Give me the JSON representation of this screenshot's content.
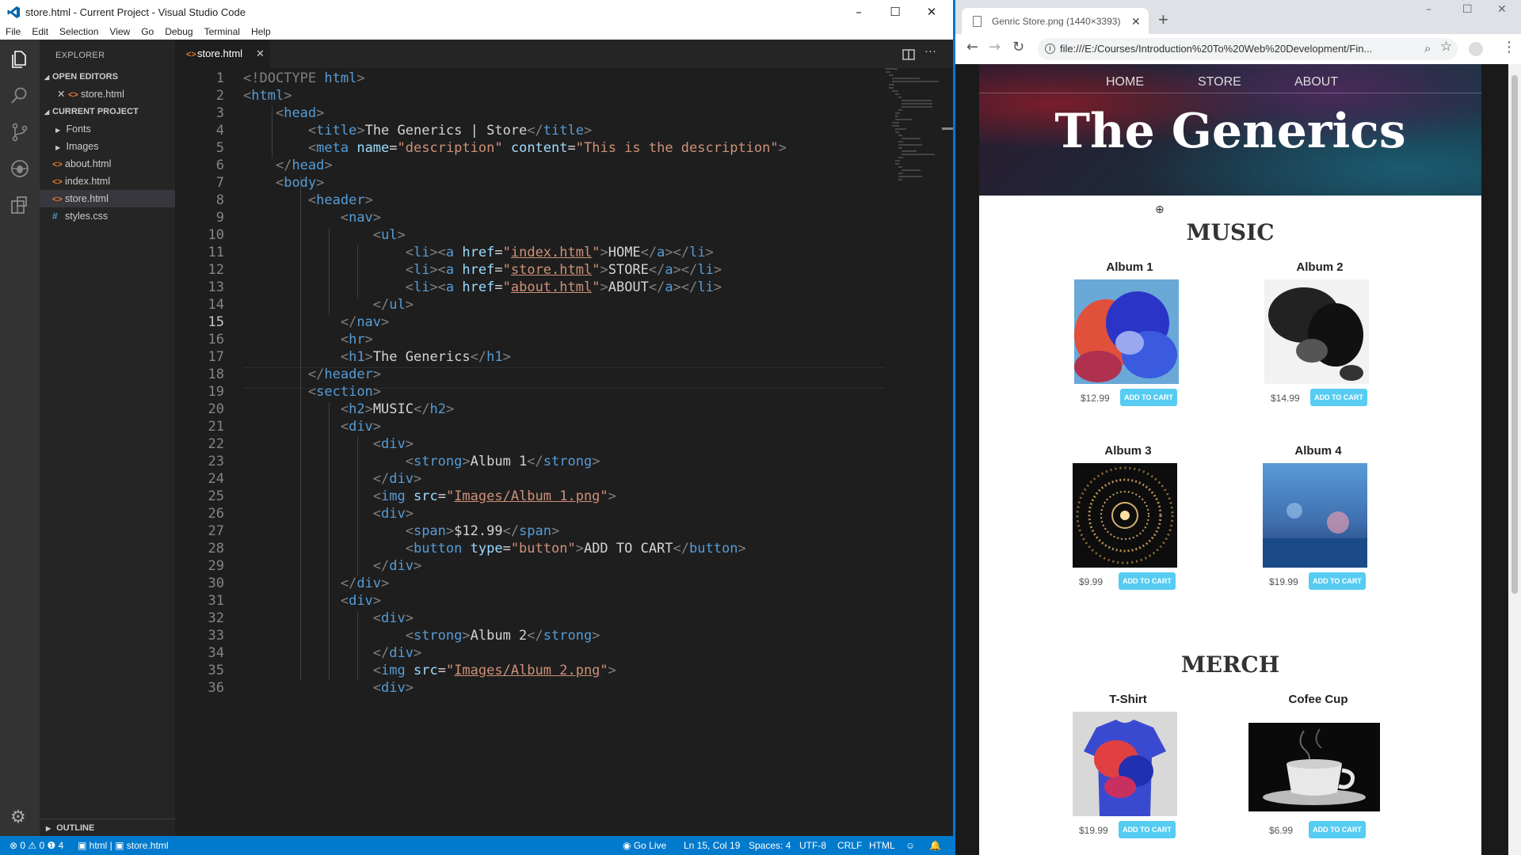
{
  "vscode": {
    "title": "store.html - Current Project - Visual Studio Code",
    "menu": [
      "File",
      "Edit",
      "Selection",
      "View",
      "Go",
      "Debug",
      "Terminal",
      "Help"
    ],
    "explorer_label": "EXPLORER",
    "open_editors_label": "OPEN EDITORS",
    "open_editor_file": "store.html",
    "project_label": "CURRENT PROJECT",
    "tree": [
      {
        "name": "Fonts",
        "kind": "folder"
      },
      {
        "name": "Images",
        "kind": "folder"
      },
      {
        "name": "about.html",
        "kind": "html"
      },
      {
        "name": "index.html",
        "kind": "html"
      },
      {
        "name": "store.html",
        "kind": "html",
        "selected": true
      },
      {
        "name": "styles.css",
        "kind": "css"
      }
    ],
    "outline_label": "OUTLINE",
    "tab_label": "store.html",
    "current_line": 15,
    "status": {
      "problems": "⊗ 0 ⚠ 0 ❶ 4",
      "breadcrumb": "▣ html | ▣ store.html",
      "golive": "Go Live",
      "position": "Ln 15, Col 19",
      "spaces": "Spaces: 4",
      "encoding": "UTF-8",
      "eol": "CRLF",
      "language": "HTML"
    },
    "code": [
      [
        [
          "t",
          "<!DOCTYPE "
        ],
        [
          "k",
          "html"
        ],
        [
          "t",
          ">"
        ]
      ],
      [
        [
          "t",
          "<"
        ],
        [
          "g",
          "html"
        ],
        [
          "t",
          ">"
        ]
      ],
      [
        [
          "w",
          "    "
        ],
        [
          "t",
          "<"
        ],
        [
          "g",
          "head"
        ],
        [
          "t",
          ">"
        ]
      ],
      [
        [
          "w",
          "        "
        ],
        [
          "t",
          "<"
        ],
        [
          "g",
          "title"
        ],
        [
          "t",
          ">"
        ],
        [
          "x",
          "The Generics | Store"
        ],
        [
          "t",
          "</"
        ],
        [
          "g",
          "title"
        ],
        [
          "t",
          ">"
        ]
      ],
      [
        [
          "w",
          "        "
        ],
        [
          "t",
          "<"
        ],
        [
          "g",
          "meta "
        ],
        [
          "a",
          "name"
        ],
        [
          "x",
          "="
        ],
        [
          "s",
          "\"description\""
        ],
        [
          "x",
          " "
        ],
        [
          "a",
          "content"
        ],
        [
          "x",
          "="
        ],
        [
          "s",
          "\"This is the description\""
        ],
        [
          "t",
          ">"
        ]
      ],
      [
        [
          "w",
          "    "
        ],
        [
          "t",
          "</"
        ],
        [
          "g",
          "head"
        ],
        [
          "t",
          ">"
        ]
      ],
      [
        [
          "w",
          "    "
        ],
        [
          "t",
          "<"
        ],
        [
          "g",
          "body"
        ],
        [
          "t",
          ">"
        ]
      ],
      [
        [
          "w",
          "        "
        ],
        [
          "t",
          "<"
        ],
        [
          "g",
          "header"
        ],
        [
          "t",
          ">"
        ]
      ],
      [
        [
          "w",
          "            "
        ],
        [
          "t",
          "<"
        ],
        [
          "g",
          "nav"
        ],
        [
          "t",
          ">"
        ]
      ],
      [
        [
          "w",
          "                "
        ],
        [
          "t",
          "<"
        ],
        [
          "g",
          "ul"
        ],
        [
          "t",
          ">"
        ]
      ],
      [
        [
          "w",
          "                    "
        ],
        [
          "t",
          "<"
        ],
        [
          "g",
          "li"
        ],
        [
          "t",
          "><"
        ],
        [
          "g",
          "a "
        ],
        [
          "a",
          "href"
        ],
        [
          "x",
          "="
        ],
        [
          "s",
          "\""
        ],
        [
          "u",
          "index.html"
        ],
        [
          "s",
          "\""
        ],
        [
          "t",
          ">"
        ],
        [
          "x",
          "HOME"
        ],
        [
          "t",
          "</"
        ],
        [
          "g",
          "a"
        ],
        [
          "t",
          "></"
        ],
        [
          "g",
          "li"
        ],
        [
          "t",
          ">"
        ]
      ],
      [
        [
          "w",
          "                    "
        ],
        [
          "t",
          "<"
        ],
        [
          "g",
          "li"
        ],
        [
          "t",
          "><"
        ],
        [
          "g",
          "a "
        ],
        [
          "a",
          "href"
        ],
        [
          "x",
          "="
        ],
        [
          "s",
          "\""
        ],
        [
          "u",
          "store.html"
        ],
        [
          "s",
          "\""
        ],
        [
          "t",
          ">"
        ],
        [
          "x",
          "STORE"
        ],
        [
          "t",
          "</"
        ],
        [
          "g",
          "a"
        ],
        [
          "t",
          "></"
        ],
        [
          "g",
          "li"
        ],
        [
          "t",
          ">"
        ]
      ],
      [
        [
          "w",
          "                    "
        ],
        [
          "t",
          "<"
        ],
        [
          "g",
          "li"
        ],
        [
          "t",
          "><"
        ],
        [
          "g",
          "a "
        ],
        [
          "a",
          "href"
        ],
        [
          "x",
          "="
        ],
        [
          "s",
          "\""
        ],
        [
          "u",
          "about.html"
        ],
        [
          "s",
          "\""
        ],
        [
          "t",
          ">"
        ],
        [
          "x",
          "ABOUT"
        ],
        [
          "t",
          "</"
        ],
        [
          "g",
          "a"
        ],
        [
          "t",
          "></"
        ],
        [
          "g",
          "li"
        ],
        [
          "t",
          ">"
        ]
      ],
      [
        [
          "w",
          "                "
        ],
        [
          "t",
          "</"
        ],
        [
          "g",
          "ul"
        ],
        [
          "t",
          ">"
        ]
      ],
      [
        [
          "w",
          "            "
        ],
        [
          "t",
          "</"
        ],
        [
          "g",
          "nav"
        ],
        [
          "t",
          ">"
        ]
      ],
      [
        [
          "w",
          "            "
        ],
        [
          "t",
          "<"
        ],
        [
          "g",
          "hr"
        ],
        [
          "t",
          ">"
        ]
      ],
      [
        [
          "w",
          "            "
        ],
        [
          "t",
          "<"
        ],
        [
          "g",
          "h1"
        ],
        [
          "t",
          ">"
        ],
        [
          "x",
          "The Generics"
        ],
        [
          "t",
          "</"
        ],
        [
          "g",
          "h1"
        ],
        [
          "t",
          ">"
        ]
      ],
      [
        [
          "w",
          "        "
        ],
        [
          "t",
          "</"
        ],
        [
          "g",
          "header"
        ],
        [
          "t",
          ">"
        ]
      ],
      [
        [
          "w",
          "        "
        ],
        [
          "t",
          "<"
        ],
        [
          "g",
          "section"
        ],
        [
          "t",
          ">"
        ]
      ],
      [
        [
          "w",
          "            "
        ],
        [
          "t",
          "<"
        ],
        [
          "g",
          "h2"
        ],
        [
          "t",
          ">"
        ],
        [
          "x",
          "MUSIC"
        ],
        [
          "t",
          "</"
        ],
        [
          "g",
          "h2"
        ],
        [
          "t",
          ">"
        ]
      ],
      [
        [
          "w",
          "            "
        ],
        [
          "t",
          "<"
        ],
        [
          "g",
          "div"
        ],
        [
          "t",
          ">"
        ]
      ],
      [
        [
          "w",
          "                "
        ],
        [
          "t",
          "<"
        ],
        [
          "g",
          "div"
        ],
        [
          "t",
          ">"
        ]
      ],
      [
        [
          "w",
          "                    "
        ],
        [
          "t",
          "<"
        ],
        [
          "g",
          "strong"
        ],
        [
          "t",
          ">"
        ],
        [
          "x",
          "Album 1"
        ],
        [
          "t",
          "</"
        ],
        [
          "g",
          "strong"
        ],
        [
          "t",
          ">"
        ]
      ],
      [
        [
          "w",
          "                "
        ],
        [
          "t",
          "</"
        ],
        [
          "g",
          "div"
        ],
        [
          "t",
          ">"
        ]
      ],
      [
        [
          "w",
          "                "
        ],
        [
          "t",
          "<"
        ],
        [
          "g",
          "img "
        ],
        [
          "a",
          "src"
        ],
        [
          "x",
          "="
        ],
        [
          "s",
          "\""
        ],
        [
          "u",
          "Images/Album 1.png"
        ],
        [
          "s",
          "\""
        ],
        [
          "t",
          ">"
        ]
      ],
      [
        [
          "w",
          "                "
        ],
        [
          "t",
          "<"
        ],
        [
          "g",
          "div"
        ],
        [
          "t",
          ">"
        ]
      ],
      [
        [
          "w",
          "                    "
        ],
        [
          "t",
          "<"
        ],
        [
          "g",
          "span"
        ],
        [
          "t",
          ">"
        ],
        [
          "x",
          "$12.99"
        ],
        [
          "t",
          "</"
        ],
        [
          "g",
          "span"
        ],
        [
          "t",
          ">"
        ]
      ],
      [
        [
          "w",
          "                    "
        ],
        [
          "t",
          "<"
        ],
        [
          "g",
          "button "
        ],
        [
          "a",
          "type"
        ],
        [
          "x",
          "="
        ],
        [
          "s",
          "\"button\""
        ],
        [
          "t",
          ">"
        ],
        [
          "x",
          "ADD TO CART"
        ],
        [
          "t",
          "</"
        ],
        [
          "g",
          "button"
        ],
        [
          "t",
          ">"
        ]
      ],
      [
        [
          "w",
          "                "
        ],
        [
          "t",
          "</"
        ],
        [
          "g",
          "div"
        ],
        [
          "t",
          ">"
        ]
      ],
      [
        [
          "w",
          "            "
        ],
        [
          "t",
          "</"
        ],
        [
          "g",
          "div"
        ],
        [
          "t",
          ">"
        ]
      ],
      [
        [
          "w",
          "            "
        ],
        [
          "t",
          "<"
        ],
        [
          "g",
          "div"
        ],
        [
          "t",
          ">"
        ]
      ],
      [
        [
          "w",
          "                "
        ],
        [
          "t",
          "<"
        ],
        [
          "g",
          "div"
        ],
        [
          "t",
          ">"
        ]
      ],
      [
        [
          "w",
          "                    "
        ],
        [
          "t",
          "<"
        ],
        [
          "g",
          "strong"
        ],
        [
          "t",
          ">"
        ],
        [
          "x",
          "Album 2"
        ],
        [
          "t",
          "</"
        ],
        [
          "g",
          "strong"
        ],
        [
          "t",
          ">"
        ]
      ],
      [
        [
          "w",
          "                "
        ],
        [
          "t",
          "</"
        ],
        [
          "g",
          "div"
        ],
        [
          "t",
          ">"
        ]
      ],
      [
        [
          "w",
          "                "
        ],
        [
          "t",
          "<"
        ],
        [
          "g",
          "img "
        ],
        [
          "a",
          "src"
        ],
        [
          "x",
          "="
        ],
        [
          "s",
          "\""
        ],
        [
          "u",
          "Images/Album 2.png"
        ],
        [
          "s",
          "\""
        ],
        [
          "t",
          ">"
        ]
      ],
      [
        [
          "w",
          "                "
        ],
        [
          "t",
          "<"
        ],
        [
          "g",
          "div"
        ],
        [
          "t",
          ">"
        ]
      ]
    ],
    "colors": {
      "tag": "#569cd6",
      "bracket": "#808080",
      "attr": "#9cdcfe",
      "string": "#ce9178",
      "text": "#d4d4d4",
      "statusbar": "#007acc"
    }
  },
  "chrome": {
    "tab_title": "Genric Store.png (1440×3393)",
    "url": "file:///E:/Courses/Introduction%20To%20Web%20Development/Fin...",
    "nav": [
      "HOME",
      "STORE",
      "ABOUT"
    ],
    "brand": "The Generics",
    "music_heading": "MUSIC",
    "merch_heading": "MERCH",
    "cart_label": "ADD TO CART",
    "albums": [
      {
        "title": "Album 1",
        "price": "$12.99",
        "art": "smoke-color"
      },
      {
        "title": "Album 2",
        "price": "$14.99",
        "art": "smoke-black"
      },
      {
        "title": "Album 3",
        "price": "$9.99",
        "art": "tunnel"
      },
      {
        "title": "Album 4",
        "price": "$19.99",
        "art": "blue-bokeh"
      }
    ],
    "merch": [
      {
        "title": "T-Shirt",
        "price": "$19.99",
        "art": "shirt"
      },
      {
        "title": "Cofee Cup",
        "price": "$6.99",
        "art": "cup"
      }
    ]
  }
}
